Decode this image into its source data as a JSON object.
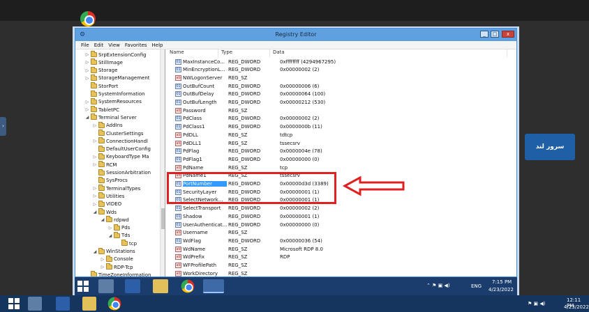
{
  "window": {
    "title": "Registry Editor",
    "min": "_",
    "max": "□",
    "close": "x"
  },
  "menu": [
    "File",
    "Edit",
    "View",
    "Favorites",
    "Help"
  ],
  "tree": [
    {
      "label": "SrpExtensionConfig",
      "depth": 2,
      "exp": "▷"
    },
    {
      "label": "StillImage",
      "depth": 2,
      "exp": "▷"
    },
    {
      "label": "Storage",
      "depth": 2,
      "exp": "▷"
    },
    {
      "label": "StorageManagement",
      "depth": 2,
      "exp": "▷"
    },
    {
      "label": "StorPort",
      "depth": 2,
      "exp": ""
    },
    {
      "label": "SystemInformation",
      "depth": 2,
      "exp": ""
    },
    {
      "label": "SystemResources",
      "depth": 2,
      "exp": "▷"
    },
    {
      "label": "TabletPC",
      "depth": 2,
      "exp": "▷"
    },
    {
      "label": "Terminal Server",
      "depth": 2,
      "exp": "◢"
    },
    {
      "label": "AddIns",
      "depth": 3,
      "exp": "▷"
    },
    {
      "label": "ClusterSettings",
      "depth": 3,
      "exp": ""
    },
    {
      "label": "ConnectionHandl",
      "depth": 3,
      "exp": "▷"
    },
    {
      "label": "DefaultUserConfig",
      "depth": 3,
      "exp": ""
    },
    {
      "label": "KeyboardType Ma",
      "depth": 3,
      "exp": "▷"
    },
    {
      "label": "RCM",
      "depth": 3,
      "exp": "▷"
    },
    {
      "label": "SessionArbitration",
      "depth": 3,
      "exp": ""
    },
    {
      "label": "SysProcs",
      "depth": 3,
      "exp": ""
    },
    {
      "label": "TerminalTypes",
      "depth": 3,
      "exp": "▷"
    },
    {
      "label": "Utilities",
      "depth": 3,
      "exp": "▷"
    },
    {
      "label": "VIDEO",
      "depth": 3,
      "exp": "▷"
    },
    {
      "label": "Wds",
      "depth": 3,
      "exp": "◢"
    },
    {
      "label": "rdpwd",
      "depth": 4,
      "exp": "◢"
    },
    {
      "label": "Pds",
      "depth": 5,
      "exp": "▷"
    },
    {
      "label": "Tds",
      "depth": 5,
      "exp": "◢"
    },
    {
      "label": "tcp",
      "depth": 6,
      "exp": ""
    },
    {
      "label": "WinStations",
      "depth": 3,
      "exp": "◢"
    },
    {
      "label": "Console",
      "depth": 4,
      "exp": "▷"
    },
    {
      "label": "RDP-Tcp",
      "depth": 4,
      "exp": "▷"
    },
    {
      "label": "TimeZoneInformation",
      "depth": 2,
      "exp": ""
    }
  ],
  "columns": {
    "name": "Name",
    "type": "Type",
    "data": "Data"
  },
  "values": [
    {
      "name": "MaxInstanceCo...",
      "type": "REG_DWORD",
      "data": "0xffffffff (4294967295)",
      "kind": "bin"
    },
    {
      "name": "MinEncryptionL...",
      "type": "REG_DWORD",
      "data": "0x00000002 (2)",
      "kind": "bin"
    },
    {
      "name": "NWLogonServer",
      "type": "REG_SZ",
      "data": "",
      "kind": "sz"
    },
    {
      "name": "OutBufCount",
      "type": "REG_DWORD",
      "data": "0x00000006 (6)",
      "kind": "bin"
    },
    {
      "name": "OutBufDelay",
      "type": "REG_DWORD",
      "data": "0x00000064 (100)",
      "kind": "bin"
    },
    {
      "name": "OutBufLength",
      "type": "REG_DWORD",
      "data": "0x00000212 (530)",
      "kind": "bin"
    },
    {
      "name": "Password",
      "type": "REG_SZ",
      "data": "",
      "kind": "sz"
    },
    {
      "name": "PdClass",
      "type": "REG_DWORD",
      "data": "0x00000002 (2)",
      "kind": "bin"
    },
    {
      "name": "PdClass1",
      "type": "REG_DWORD",
      "data": "0x0000000b (11)",
      "kind": "bin"
    },
    {
      "name": "PdDLL",
      "type": "REG_SZ",
      "data": "tdtcp",
      "kind": "sz"
    },
    {
      "name": "PdDLL1",
      "type": "REG_SZ",
      "data": "tssecsrv",
      "kind": "sz"
    },
    {
      "name": "PdFlag",
      "type": "REG_DWORD",
      "data": "0x0000004e (78)",
      "kind": "bin"
    },
    {
      "name": "PdFlag1",
      "type": "REG_DWORD",
      "data": "0x00000000 (0)",
      "kind": "bin"
    },
    {
      "name": "PdName",
      "type": "REG_SZ",
      "data": "tcp",
      "kind": "sz"
    },
    {
      "name": "PdName1",
      "type": "REG_SZ",
      "data": "tssecsrv",
      "kind": "sz"
    },
    {
      "name": "PortNumber",
      "type": "REG_DWORD",
      "data": "0x00000d3d (3389)",
      "kind": "bin",
      "selected": true
    },
    {
      "name": "SecurityLayer",
      "type": "REG_DWORD",
      "data": "0x00000001 (1)",
      "kind": "bin"
    },
    {
      "name": "SelectNetwork...",
      "type": "REG_DWORD",
      "data": "0x00000001 (1)",
      "kind": "bin"
    },
    {
      "name": "SelectTransport",
      "type": "REG_DWORD",
      "data": "0x00000002 (2)",
      "kind": "bin"
    },
    {
      "name": "Shadow",
      "type": "REG_DWORD",
      "data": "0x00000001 (1)",
      "kind": "bin"
    },
    {
      "name": "UserAuthenticat...",
      "type": "REG_DWORD",
      "data": "0x00000000 (0)",
      "kind": "bin"
    },
    {
      "name": "Username",
      "type": "REG_SZ",
      "data": "",
      "kind": "sz"
    },
    {
      "name": "WdFlag",
      "type": "REG_DWORD",
      "data": "0x00000036 (54)",
      "kind": "bin"
    },
    {
      "name": "WdName",
      "type": "REG_SZ",
      "data": "Microsoft RDP 8.0",
      "kind": "sz"
    },
    {
      "name": "WdPrefix",
      "type": "REG_SZ",
      "data": "RDP",
      "kind": "sz"
    },
    {
      "name": "WFProfilePath",
      "type": "REG_SZ",
      "data": "",
      "kind": "sz"
    },
    {
      "name": "WorkDirectory",
      "type": "REG_SZ",
      "data": "",
      "kind": "sz"
    }
  ],
  "remote_taskbar": {
    "lang": "ENG",
    "time": "7:15 PM",
    "date": "4/23/2022"
  },
  "local_taskbar": {
    "time": "12:11 PM",
    "date": "4/23/2022"
  },
  "watermark": {
    "text": "سرور لند"
  },
  "colors": {
    "annotation": "#e02020",
    "selected": "#3399ff",
    "titlebar": "#5ea0e0"
  }
}
